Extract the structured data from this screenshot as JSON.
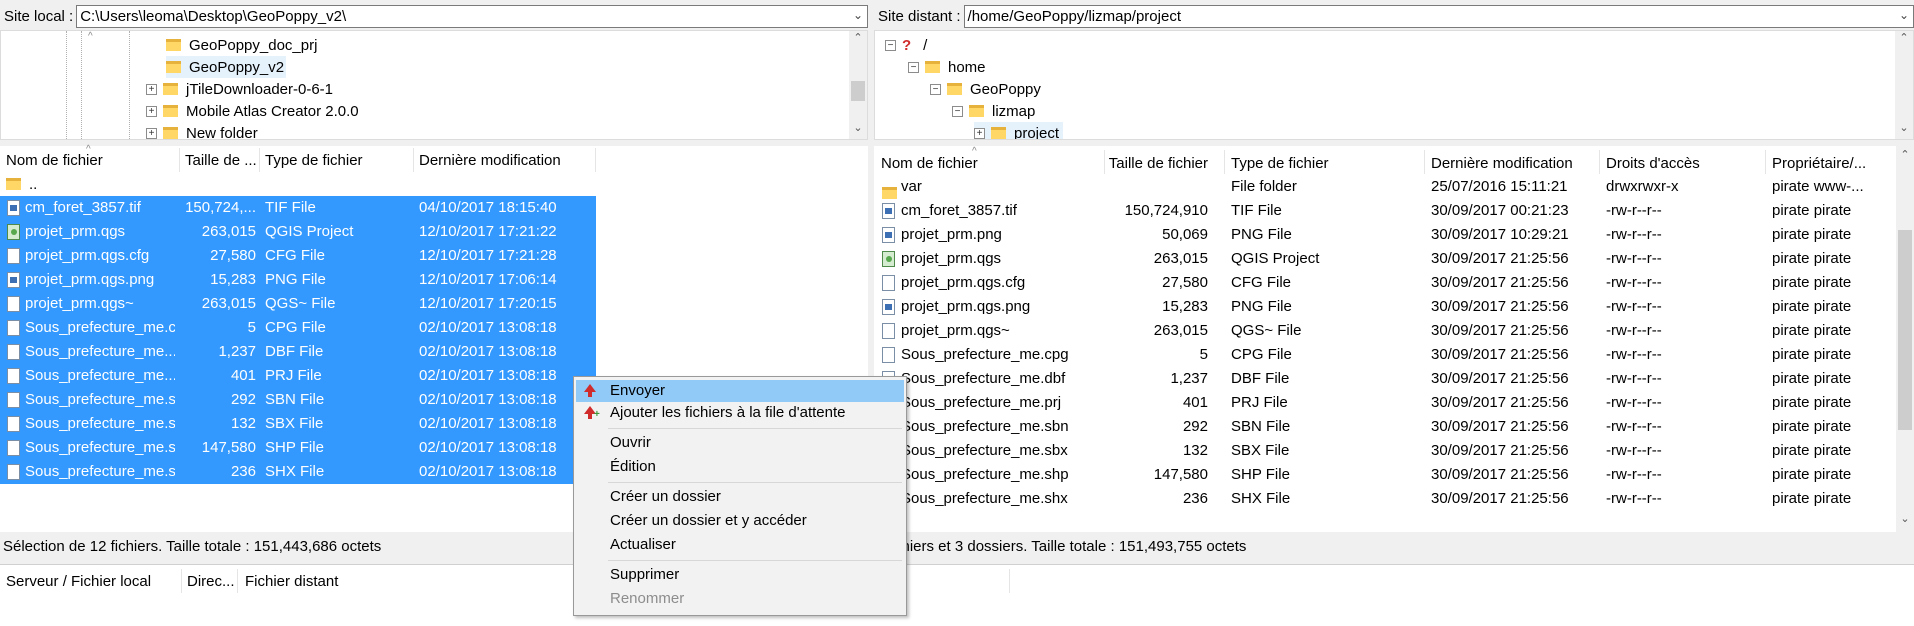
{
  "local": {
    "label": "Site local :",
    "path": "C:\\Users\\leoma\\Desktop\\GeoPoppy_v2\\",
    "tree": [
      "GeoPoppy_doc_prj",
      "GeoPoppy_v2",
      "jTileDownloader-0-6-1",
      "Mobile Atlas Creator 2.0.0",
      "New folder"
    ],
    "columns": [
      "Nom de fichier",
      "Taille de ...",
      "Type de fichier",
      "Dernière modification"
    ],
    "parent_dir": "..",
    "files": [
      {
        "name": "cm_foret_3857.tif",
        "size": "150,724,...",
        "type": "TIF File",
        "date": "04/10/2017 18:15:40",
        "icon": "image-file"
      },
      {
        "name": "projet_prm.qgs",
        "size": "263,015",
        "type": "QGIS Project",
        "date": "12/10/2017 17:21:22",
        "icon": "qgis-file"
      },
      {
        "name": "projet_prm.qgs.cfg",
        "size": "27,580",
        "type": "CFG File",
        "date": "12/10/2017 17:21:28",
        "icon": "file"
      },
      {
        "name": "projet_prm.qgs.png",
        "size": "15,283",
        "type": "PNG File",
        "date": "12/10/2017 17:06:14",
        "icon": "image-file"
      },
      {
        "name": "projet_prm.qgs~",
        "size": "263,015",
        "type": "QGS~ File",
        "date": "12/10/2017 17:20:15",
        "icon": "file"
      },
      {
        "name": "Sous_prefecture_me.c...",
        "size": "5",
        "type": "CPG File",
        "date": "02/10/2017 13:08:18",
        "icon": "file"
      },
      {
        "name": "Sous_prefecture_me....",
        "size": "1,237",
        "type": "DBF File",
        "date": "02/10/2017 13:08:18",
        "icon": "file"
      },
      {
        "name": "Sous_prefecture_me....",
        "size": "401",
        "type": "PRJ File",
        "date": "02/10/2017 13:08:18",
        "icon": "file"
      },
      {
        "name": "Sous_prefecture_me.s...",
        "size": "292",
        "type": "SBN File",
        "date": "02/10/2017 13:08:18",
        "icon": "file"
      },
      {
        "name": "Sous_prefecture_me.s...",
        "size": "132",
        "type": "SBX File",
        "date": "02/10/2017 13:08:18",
        "icon": "file"
      },
      {
        "name": "Sous_prefecture_me.s...",
        "size": "147,580",
        "type": "SHP File",
        "date": "02/10/2017 13:08:18",
        "icon": "file"
      },
      {
        "name": "Sous_prefecture_me.s...",
        "size": "236",
        "type": "SHX File",
        "date": "02/10/2017 13:08:18",
        "icon": "file"
      }
    ],
    "status": "Sélection de 12 fichiers. Taille totale : 151,443,686 octets"
  },
  "remote": {
    "label": "Site distant :",
    "path": "/home/GeoPoppy/lizmap/project",
    "tree": [
      "/",
      "home",
      "GeoPoppy",
      "lizmap",
      "project"
    ],
    "columns": [
      "Nom de fichier",
      "Taille de fichier",
      "Type de fichier",
      "Dernière modification",
      "Droits d'accès",
      "Propriétaire/..."
    ],
    "files": [
      {
        "name": "var",
        "size": "",
        "type": "File folder",
        "date": "25/07/2016 15:11:21",
        "perms": "drwxrwxr-x",
        "owner": "pirate www-...",
        "icon": "folder"
      },
      {
        "name": "cm_foret_3857.tif",
        "size": "150,724,910",
        "type": "TIF File",
        "date": "30/09/2017 00:21:23",
        "perms": "-rw-r--r--",
        "owner": "pirate pirate",
        "icon": "image-file"
      },
      {
        "name": "projet_prm.png",
        "size": "50,069",
        "type": "PNG File",
        "date": "30/09/2017 10:29:21",
        "perms": "-rw-r--r--",
        "owner": "pirate pirate",
        "icon": "image-file"
      },
      {
        "name": "projet_prm.qgs",
        "size": "263,015",
        "type": "QGIS Project",
        "date": "30/09/2017 21:25:56",
        "perms": "-rw-r--r--",
        "owner": "pirate pirate",
        "icon": "qgis-file"
      },
      {
        "name": "projet_prm.qgs.cfg",
        "size": "27,580",
        "type": "CFG File",
        "date": "30/09/2017 21:25:56",
        "perms": "-rw-r--r--",
        "owner": "pirate pirate",
        "icon": "file"
      },
      {
        "name": "projet_prm.qgs.png",
        "size": "15,283",
        "type": "PNG File",
        "date": "30/09/2017 21:25:56",
        "perms": "-rw-r--r--",
        "owner": "pirate pirate",
        "icon": "image-file"
      },
      {
        "name": "projet_prm.qgs~",
        "size": "263,015",
        "type": "QGS~ File",
        "date": "30/09/2017 21:25:56",
        "perms": "-rw-r--r--",
        "owner": "pirate pirate",
        "icon": "file"
      },
      {
        "name": "Sous_prefecture_me.cpg",
        "size": "5",
        "type": "CPG File",
        "date": "30/09/2017 21:25:56",
        "perms": "-rw-r--r--",
        "owner": "pirate pirate",
        "icon": "file"
      },
      {
        "name": "Sous_prefecture_me.dbf",
        "size": "1,237",
        "type": "DBF File",
        "date": "30/09/2017 21:25:56",
        "perms": "-rw-r--r--",
        "owner": "pirate pirate",
        "icon": "file"
      },
      {
        "name": "Sous_prefecture_me.prj",
        "size": "401",
        "type": "PRJ File",
        "date": "30/09/2017 21:25:56",
        "perms": "-rw-r--r--",
        "owner": "pirate pirate",
        "icon": "file"
      },
      {
        "name": "Sous_prefecture_me.sbn",
        "size": "292",
        "type": "SBN File",
        "date": "30/09/2017 21:25:56",
        "perms": "-rw-r--r--",
        "owner": "pirate pirate",
        "icon": "file"
      },
      {
        "name": "Sous_prefecture_me.sbx",
        "size": "132",
        "type": "SBX File",
        "date": "30/09/2017 21:25:56",
        "perms": "-rw-r--r--",
        "owner": "pirate pirate",
        "icon": "file"
      },
      {
        "name": "Sous_prefecture_me.shp",
        "size": "147,580",
        "type": "SHP File",
        "date": "30/09/2017 21:25:56",
        "perms": "-rw-r--r--",
        "owner": "pirate pirate",
        "icon": "file"
      },
      {
        "name": "Sous_prefecture_me.shx",
        "size": "236",
        "type": "SHX File",
        "date": "30/09/2017 21:25:56",
        "perms": "-rw-r--r--",
        "owner": "pirate pirate",
        "icon": "file"
      }
    ],
    "status": "chiers et 3 dossiers. Taille totale : 151,493,755 octets"
  },
  "queue": {
    "columns": [
      "Serveur / Fichier local",
      "Direc...",
      "Fichier distant"
    ]
  },
  "context_menu": {
    "items": [
      {
        "label": "Envoyer",
        "state": "highlighted",
        "icon": "upload-icon"
      },
      {
        "label": "Ajouter les fichiers à la file d'attente",
        "state": "normal",
        "icon": "add-to-queue-icon"
      },
      {
        "label": "Ouvrir",
        "state": "normal"
      },
      {
        "label": "Édition",
        "state": "normal"
      },
      {
        "label": "Créer un dossier",
        "state": "normal"
      },
      {
        "label": "Créer un dossier et y accéder",
        "state": "normal"
      },
      {
        "label": "Actualiser",
        "state": "normal"
      },
      {
        "label": "Supprimer",
        "state": "normal"
      },
      {
        "label": "Renommer",
        "state": "disabled"
      }
    ]
  },
  "colors": {
    "selection": "#3399ff",
    "menu_highlight": "#91c9f7"
  }
}
